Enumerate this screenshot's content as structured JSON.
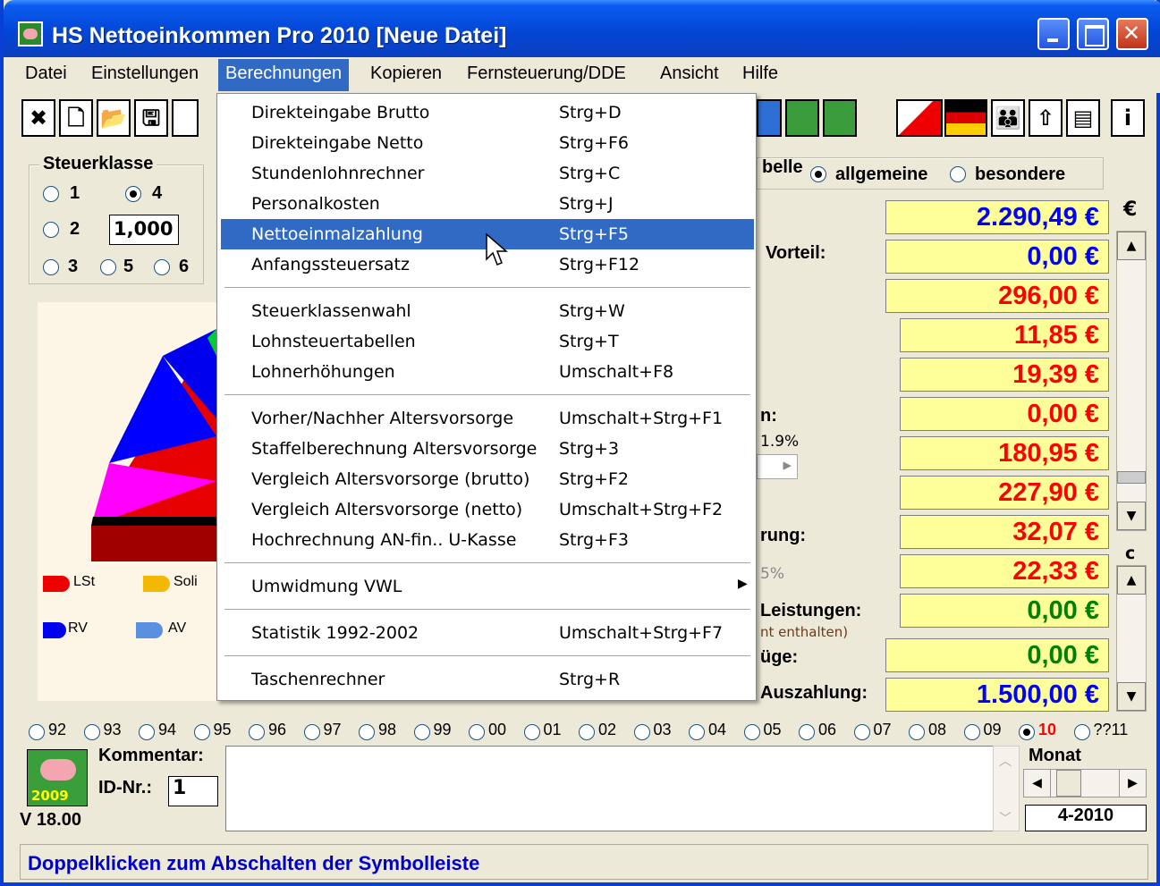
{
  "window": {
    "title": "HS  Nettoeinkommen Pro 2010 [Neue Datei]"
  },
  "menubar": [
    "Datei",
    "Einstellungen",
    "Berechnungen",
    "Kopieren",
    "Fernsteuerung/DDE",
    "Ansicht",
    "Hilfe"
  ],
  "active_menu": "Berechnungen",
  "dropdown": {
    "items": [
      {
        "label": "Direkteingabe Brutto",
        "shortcut": "Strg+D"
      },
      {
        "label": "Direkteingabe Netto",
        "shortcut": "Strg+F6"
      },
      {
        "label": "Stundenlohnrechner",
        "shortcut": "Strg+C"
      },
      {
        "label": "Personalkosten",
        "shortcut": "Strg+J"
      },
      {
        "label": "Nettoeinmalzahlung",
        "shortcut": "Strg+F5"
      },
      {
        "label": "Anfangssteuersatz",
        "shortcut": "Strg+F12"
      },
      {
        "label": "Steuerklassenwahl",
        "shortcut": "Strg+W"
      },
      {
        "label": "Lohnsteuertabellen",
        "shortcut": "Strg+T"
      },
      {
        "label": "Lohnerhöhungen",
        "shortcut": "Umschalt+F8"
      },
      {
        "label": "Vorher/Nachher Altersvorsorge",
        "shortcut": "Umschalt+Strg+F1"
      },
      {
        "label": "Staffelberechnung Altersvorsorge",
        "shortcut": "Strg+3"
      },
      {
        "label": "Vergleich Altersvorsorge (brutto)",
        "shortcut": "Strg+F2"
      },
      {
        "label": "Vergleich Altersvorsorge (netto)",
        "shortcut": "Umschalt+Strg+F2"
      },
      {
        "label": "Hochrechnung AN-fin.. U-Kasse",
        "shortcut": "Strg+F3"
      },
      {
        "label": "Umwidmung VWL",
        "shortcut": ""
      },
      {
        "label": "Statistik 1992-2002",
        "shortcut": "Umschalt+Strg+F7"
      },
      {
        "label": "Taschenrechner",
        "shortcut": "Strg+R"
      }
    ],
    "highlighted": "Nettoeinmalzahlung"
  },
  "steuerklasse": {
    "title": "Steuerklasse",
    "options": [
      "1",
      "4",
      "2",
      "3",
      "5",
      "6"
    ],
    "selected": "4",
    "factor": "1,000"
  },
  "tabelle": {
    "label_partial": "belle",
    "options": [
      "allgemeine",
      "besondere"
    ],
    "selected": "allgemeine"
  },
  "values": [
    {
      "label": "",
      "value": "2.290,49 €",
      "color": "#0000ff"
    },
    {
      "label": "Vorteil:",
      "value": "0,00 €",
      "color": "#0000ff"
    },
    {
      "label": "",
      "value": "296,00 €",
      "color": "#ff0000"
    },
    {
      "label": "",
      "value": "11,85 €",
      "color": "#ff0000"
    },
    {
      "label": "",
      "value": "19,39 €",
      "color": "#ff0000"
    },
    {
      "label": "n:",
      "value": "0,00 €",
      "color": "#ff0000"
    },
    {
      "label": "",
      "value": "180,95 €",
      "color": "#ff0000"
    },
    {
      "label": "",
      "value": "227,90 €",
      "color": "#ff0000"
    },
    {
      "label": "rung:",
      "value": "32,07 €",
      "color": "#ff0000"
    },
    {
      "label": "",
      "value": "22,33 €",
      "color": "#ff0000"
    },
    {
      "label": "Leistungen:",
      "value": "0,00 €",
      "color": "#008000"
    },
    {
      "label": "üge:",
      "value": "0,00 €",
      "color": "#008000"
    },
    {
      "label": "Auszahlung:",
      "value": "1.500,00 €",
      "color": "#0000ff"
    }
  ],
  "partial_texts": {
    "pct1": "1.9%",
    "pct2": "5%",
    "enthalten": "nt enthalten)"
  },
  "currency_symbol": "€",
  "c_label": "c",
  "legend": [
    "LSt",
    "Soli",
    "RV",
    "AV"
  ],
  "years": [
    "92",
    "93",
    "94",
    "95",
    "96",
    "97",
    "98",
    "99",
    "00",
    "01",
    "02",
    "03",
    "04",
    "05",
    "06",
    "07",
    "08",
    "09",
    "10",
    "??11"
  ],
  "selected_year": "10",
  "bottom": {
    "kommentar_label": "Kommentar:",
    "id_label": "ID-Nr.:",
    "id_value": "1",
    "version": "V 18.00",
    "logo_year": "2009",
    "monat_label": "Monat",
    "monat_value": "4-2010"
  },
  "statusbar": "Doppelklicken zum Abschalten der Symbolleiste",
  "toolbar_icons": [
    "close-file-icon",
    "new-file-icon",
    "open-folder-icon",
    "save-disk-icon",
    "print-icon",
    "tree-tp-icon",
    "tree-tp-icon",
    "staircase-chart-icon",
    "german-flag-icon",
    "people-icon",
    "arrow-up-icon",
    "calculator-icon",
    "info-icon"
  ]
}
